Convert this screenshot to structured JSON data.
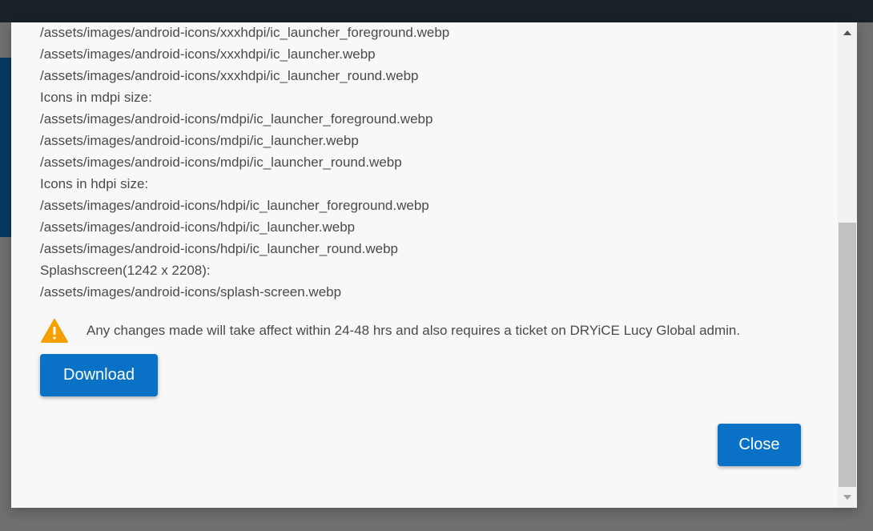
{
  "modal": {
    "lines": [
      "/assets/images/android-icons/xxxhdpi/ic_launcher_foreground.webp",
      "/assets/images/android-icons/xxxhdpi/ic_launcher.webp",
      "/assets/images/android-icons/xxxhdpi/ic_launcher_round.webp",
      "Icons in mdpi size:",
      "/assets/images/android-icons/mdpi/ic_launcher_foreground.webp",
      "/assets/images/android-icons/mdpi/ic_launcher.webp",
      "/assets/images/android-icons/mdpi/ic_launcher_round.webp",
      "Icons in hdpi size:",
      "/assets/images/android-icons/hdpi/ic_launcher_foreground.webp",
      "/assets/images/android-icons/hdpi/ic_launcher.webp",
      "/assets/images/android-icons/hdpi/ic_launcher_round.webp",
      "Splashscreen(1242 x 2208):",
      "/assets/images/android-icons/splash-screen.webp"
    ],
    "warning": {
      "icon": "warning-triangle-icon",
      "text": "Any changes made will take affect within 24-48 hrs and also requires a ticket on DRYiCE Lucy Global admin."
    },
    "download_label": "Download",
    "close_label": "Close"
  },
  "colors": {
    "accent": "#0a72c6",
    "warning": "#f5a000",
    "overlay": "#6f6f6f",
    "topbar": "#1b2227"
  },
  "scrollbar": {
    "up_icon": "scroll-up-arrow-icon",
    "down_icon": "scroll-down-arrow-icon"
  }
}
